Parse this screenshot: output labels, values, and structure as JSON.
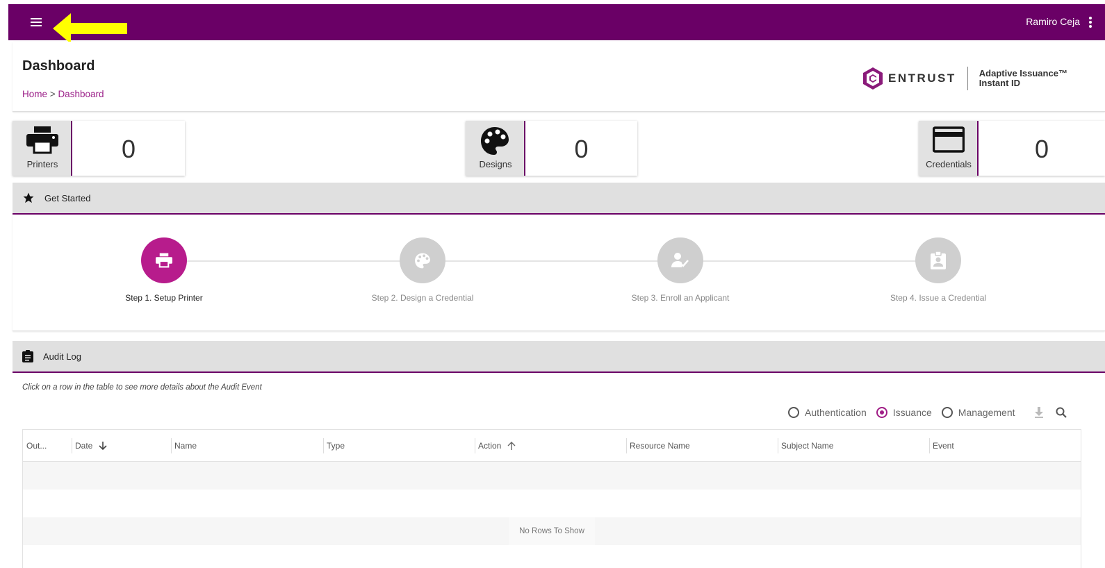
{
  "topbar": {
    "user_name": "Ramiro Ceja"
  },
  "header": {
    "title": "Dashboard",
    "breadcrumb": {
      "home": "Home",
      "separator": ">",
      "current": "Dashboard"
    },
    "brand": {
      "name": "ENTRUST",
      "product_line1": "Adaptive Issuance™",
      "product_line2": "Instant ID"
    }
  },
  "stats": [
    {
      "label": "Printers",
      "value": "0",
      "icon": "printer-icon"
    },
    {
      "label": "Designs",
      "value": "0",
      "icon": "palette-icon"
    },
    {
      "label": "Credentials",
      "value": "0",
      "icon": "credit-card-icon"
    }
  ],
  "get_started": {
    "title": "Get Started",
    "steps": [
      {
        "label": "Step 1. Setup Printer",
        "icon": "printer-icon",
        "active": true
      },
      {
        "label": "Step 2. Design a Credential",
        "icon": "palette-icon",
        "active": false
      },
      {
        "label": "Step 3. Enroll an Applicant",
        "icon": "person-check-icon",
        "active": false
      },
      {
        "label": "Step 4. Issue a Credential",
        "icon": "badge-icon",
        "active": false
      }
    ]
  },
  "audit_log": {
    "title": "Audit Log",
    "hint": "Click on a row in the table to see more details about the Audit Event",
    "filters": [
      {
        "label": "Authentication",
        "checked": false
      },
      {
        "label": "Issuance",
        "checked": true
      },
      {
        "label": "Management",
        "checked": false
      }
    ],
    "columns": [
      "Out...",
      "Date",
      "Name",
      "Type",
      "Action",
      "Resource Name",
      "Subject Name",
      "Event"
    ],
    "empty_message": "No Rows To Show"
  },
  "colors": {
    "primary": "#6a0066",
    "accent": "#b71c8c",
    "annotation_arrow": "#ffff00"
  }
}
